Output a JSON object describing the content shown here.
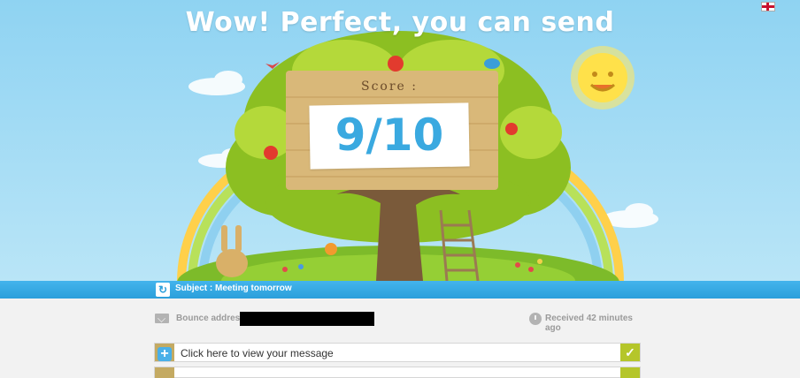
{
  "header": {
    "headline": "Wow! Perfect, you can send"
  },
  "score": {
    "label": "Score :",
    "value": "9/10"
  },
  "subject": {
    "text": "Subject : Meeting tomorrow",
    "icon": "refresh-icon"
  },
  "info": {
    "bounce_label": "Bounce address :",
    "bounce_value": "",
    "received": "Received 42 minutes ago"
  },
  "message": {
    "view_label": "Click here to view your message"
  },
  "colors": {
    "sky": "#8fd3f2",
    "subject_bar": "#2b9fdb",
    "score_text": "#3aa9e0",
    "check": "#b5c62a",
    "plus_frame": "#c4aa62"
  }
}
